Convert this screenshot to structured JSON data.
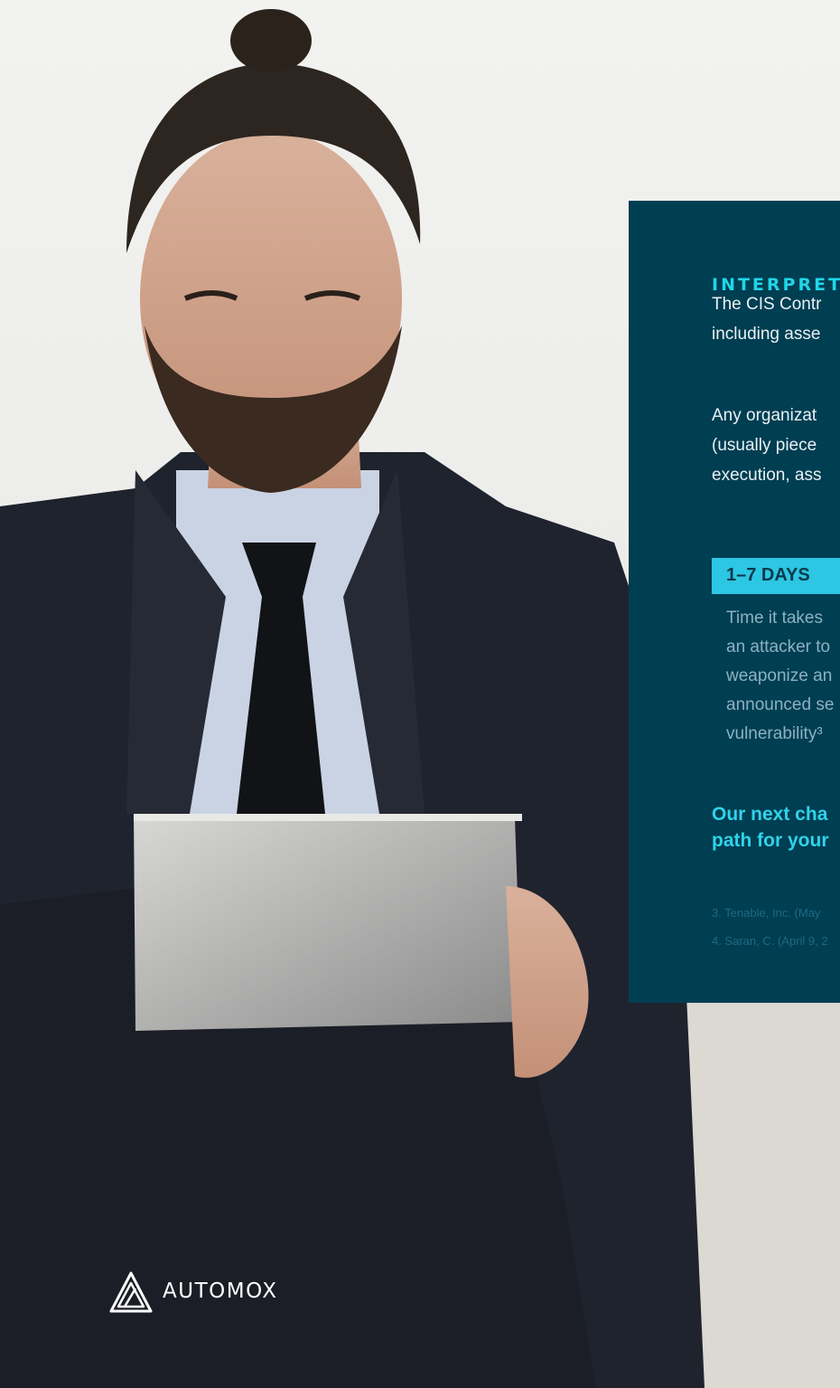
{
  "panel": {
    "heading": "INTERPRET",
    "paragraph_1_lines": [
      "The CIS Contr",
      "including asse"
    ],
    "paragraph_2_lines": [
      "Any organizat",
      "(usually piece",
      "execution, ass"
    ],
    "stat": {
      "label": "1–7 DAYS",
      "text_lines": [
        "Time it takes",
        "an attacker to",
        "weaponize an",
        "announced se",
        "vulnerability³"
      ]
    },
    "callout_lines": [
      "Our next cha",
      "path for your"
    ],
    "footnotes": [
      "3. Tenable, Inc. (May",
      "4. Saran, C. (April 9, 2"
    ]
  },
  "logo": {
    "icon": "automox-logo-icon",
    "wordmark": "AUTOMOX"
  },
  "photo": {
    "subject": "person-with-tablet-photo"
  },
  "colors": {
    "panel_bg": "#003e52",
    "accent": "#20d6e8",
    "badge": "#2dc6e3"
  }
}
